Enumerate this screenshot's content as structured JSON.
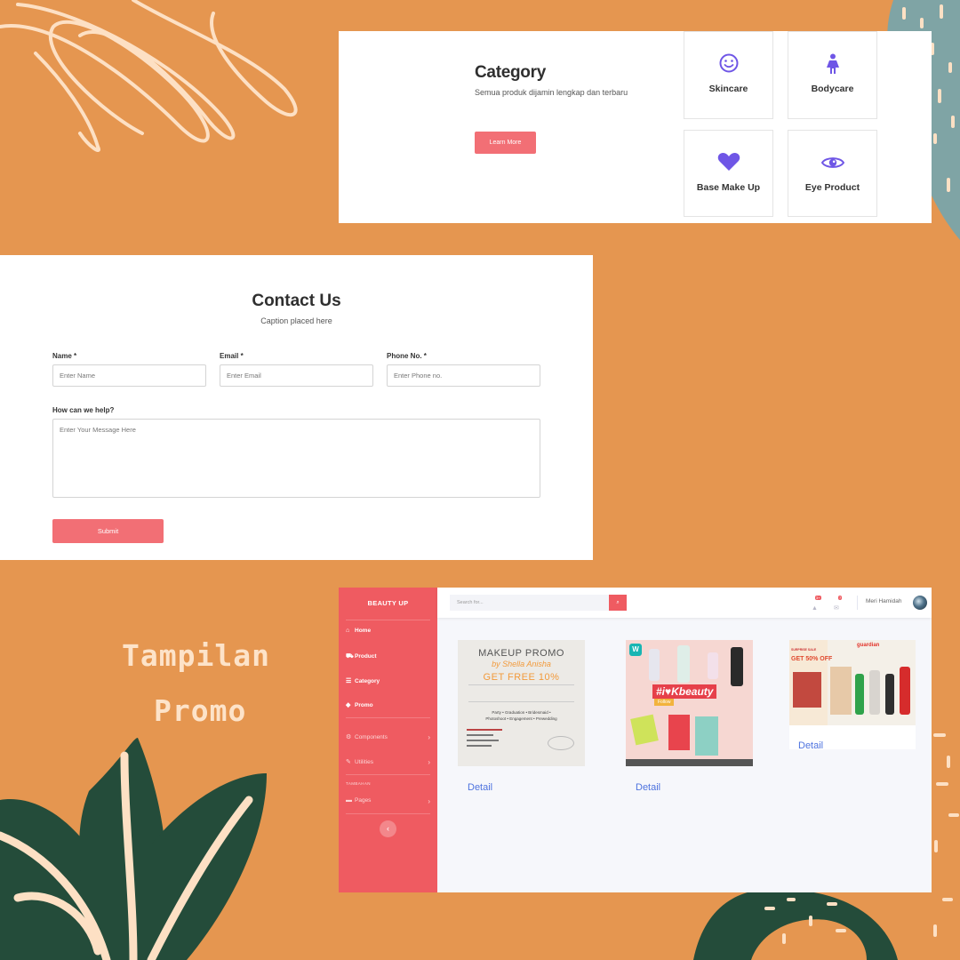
{
  "colors": {
    "background": "#e59650",
    "accent": "#f26f75",
    "icon": "#6f56e6",
    "sidebar": "#ef5b61"
  },
  "category": {
    "title": "Category",
    "subtitle": "Semua produk dijamin lengkap dan terbaru",
    "button_label": "Learn More",
    "items": [
      {
        "label": "Skincare",
        "icon": "smile-icon"
      },
      {
        "label": "Bodycare",
        "icon": "person-icon"
      },
      {
        "label": "Base Make Up",
        "icon": "heart-icon"
      },
      {
        "label": "Eye Product",
        "icon": "eye-icon"
      }
    ]
  },
  "contact": {
    "title": "Contact Us",
    "caption": "Caption placed here",
    "name_label": "Name *",
    "name_placeholder": "Enter Name",
    "email_label": "Email *",
    "email_placeholder": "Enter Email",
    "phone_label": "Phone No. *",
    "phone_placeholder": "Enter Phone no.",
    "message_label": "How can we help?",
    "message_placeholder": "Enter Your Message Here",
    "submit_label": "Submit"
  },
  "caption": {
    "line1": "Tampilan",
    "line2": "Promo"
  },
  "admin": {
    "brand": "BEAUTY UP",
    "nav": [
      {
        "label": "Home",
        "icon": "home-icon"
      },
      {
        "label": "Product",
        "icon": "cart-icon"
      },
      {
        "label": "Category",
        "icon": "list-icon"
      },
      {
        "label": "Promo",
        "icon": "tag-icon"
      }
    ],
    "nav_secondary": [
      {
        "label": "Components",
        "icon": "gear-icon"
      },
      {
        "label": "Utilities",
        "icon": "wrench-icon"
      }
    ],
    "section_heading": "TAMBAHAN",
    "pages_label": "Pages",
    "search_placeholder": "Search for...",
    "alerts_count": "3+",
    "messages_count": "7",
    "user_name": "Meri Hamidah",
    "promos": [
      {
        "detail_label": "Detail",
        "title": "MAKEUP PROMO",
        "by": "by Shella Anisha",
        "offer": "GET FREE 10%",
        "services": "Party • Graduation • Bridesmaid • Photoshoot • Engagement • Prewedding"
      },
      {
        "detail_label": "Detail",
        "brand": "W",
        "headline": "#i♥Kbeauty",
        "tag": "Follow"
      },
      {
        "detail_label": "Detail",
        "tag": "SURPRISE SALE",
        "offer": "GET 50% OFF",
        "brand": "guardian"
      }
    ]
  }
}
